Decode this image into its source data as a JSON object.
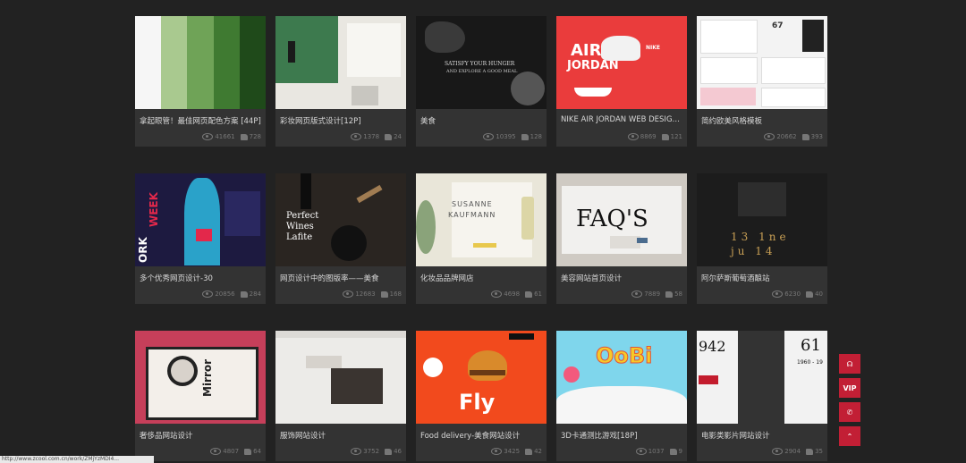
{
  "cards": [
    {
      "title": "拿起眼管！最佳网页配色方案 [44P]",
      "views": "41661",
      "likes": "728"
    },
    {
      "title": "彩妆网页版式设计[12P]",
      "views": "1378",
      "likes": "24"
    },
    {
      "title": "美食",
      "views": "10395",
      "likes": "128"
    },
    {
      "title": "NIKE AIR JORDAN WEB DESIGN-...",
      "views": "8869",
      "likes": "121"
    },
    {
      "title": "简约欧美风格模板",
      "views": "20662",
      "likes": "393"
    },
    {
      "title": "多个优秀网页设计-30",
      "views": "20856",
      "likes": "284"
    },
    {
      "title": "网页设计中的图版率——美食",
      "views": "12683",
      "likes": "168"
    },
    {
      "title": "化妆品品牌网店",
      "views": "4698",
      "likes": "61"
    },
    {
      "title": "美容网站首页设计",
      "views": "7889",
      "likes": "58"
    },
    {
      "title": "阿尔萨斯葡萄酒酿站",
      "views": "6230",
      "likes": "40"
    },
    {
      "title": "奢侈品网站设计",
      "views": "4807",
      "likes": "64"
    },
    {
      "title": "服饰网站设计",
      "views": "3752",
      "likes": "46"
    },
    {
      "title": "Food delivery-美食网站设计",
      "views": "3425",
      "likes": "42"
    },
    {
      "title": "3D卡通测比游戏[18P]",
      "views": "1037",
      "likes": "9"
    },
    {
      "title": "电影类影片网站设计",
      "views": "2904",
      "likes": "35"
    }
  ],
  "thumb_text": {
    "t3_headline": "SATISFY YOUR HUNGER",
    "t3_sub": "AND EXPLORE A GOOD MEAL",
    "t4_air": "AIR",
    "t4_jordan": "JORDAN",
    "t4_nike": "NIKE",
    "t5_num": "67",
    "t6_week": "WEEK",
    "t6_ork": "ORK",
    "t7_perfect": "Perfect",
    "t7_wines": "Wines",
    "t7_lafite": "Lafite",
    "t8_susanne": "SUSANNE",
    "t8_kaufmann": "KAUFMANN",
    "t9_faq": "FAQ'S",
    "t10_line1": "13 1ne",
    "t10_line2": "ju 14",
    "t11_mirror": "Mirror",
    "t13_fly": "Fly",
    "t14_logo": "OoBi",
    "t15_942": "942",
    "t15_61": "61",
    "t15_years": "1960 - 19"
  },
  "sidebar": {
    "headset": "☊",
    "vip": "VIP",
    "wechat": "✆",
    "top": "⌃"
  },
  "status_url": "http://www.zcool.com.cn/work/ZMjYzMDI4..."
}
